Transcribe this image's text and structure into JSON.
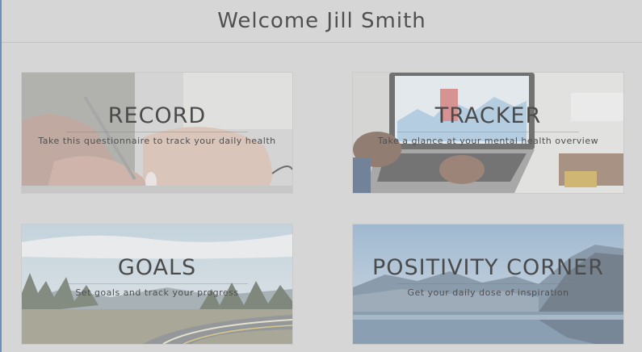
{
  "header": {
    "title": "Welcome Jill Smith"
  },
  "cards": [
    {
      "title": "RECORD",
      "description": "Take this questionnaire to track your daily health",
      "image": "hand-writing-with-pen-photo"
    },
    {
      "title": "TRACKER",
      "description": "Take a glance at your mental health overview",
      "image": "laptop-with-charts-photo"
    },
    {
      "title": "GOALS",
      "description": "Set goals and track your progress",
      "image": "mountain-road-photo"
    },
    {
      "title": "POSITIVITY CORNER",
      "description": "Get your daily dose of inspiration",
      "image": "mountain-lake-photo"
    }
  ],
  "colors": {
    "background": "#d6d6d6",
    "title_text": "#4b4b4b",
    "accent_line": "#6b8fbf"
  }
}
